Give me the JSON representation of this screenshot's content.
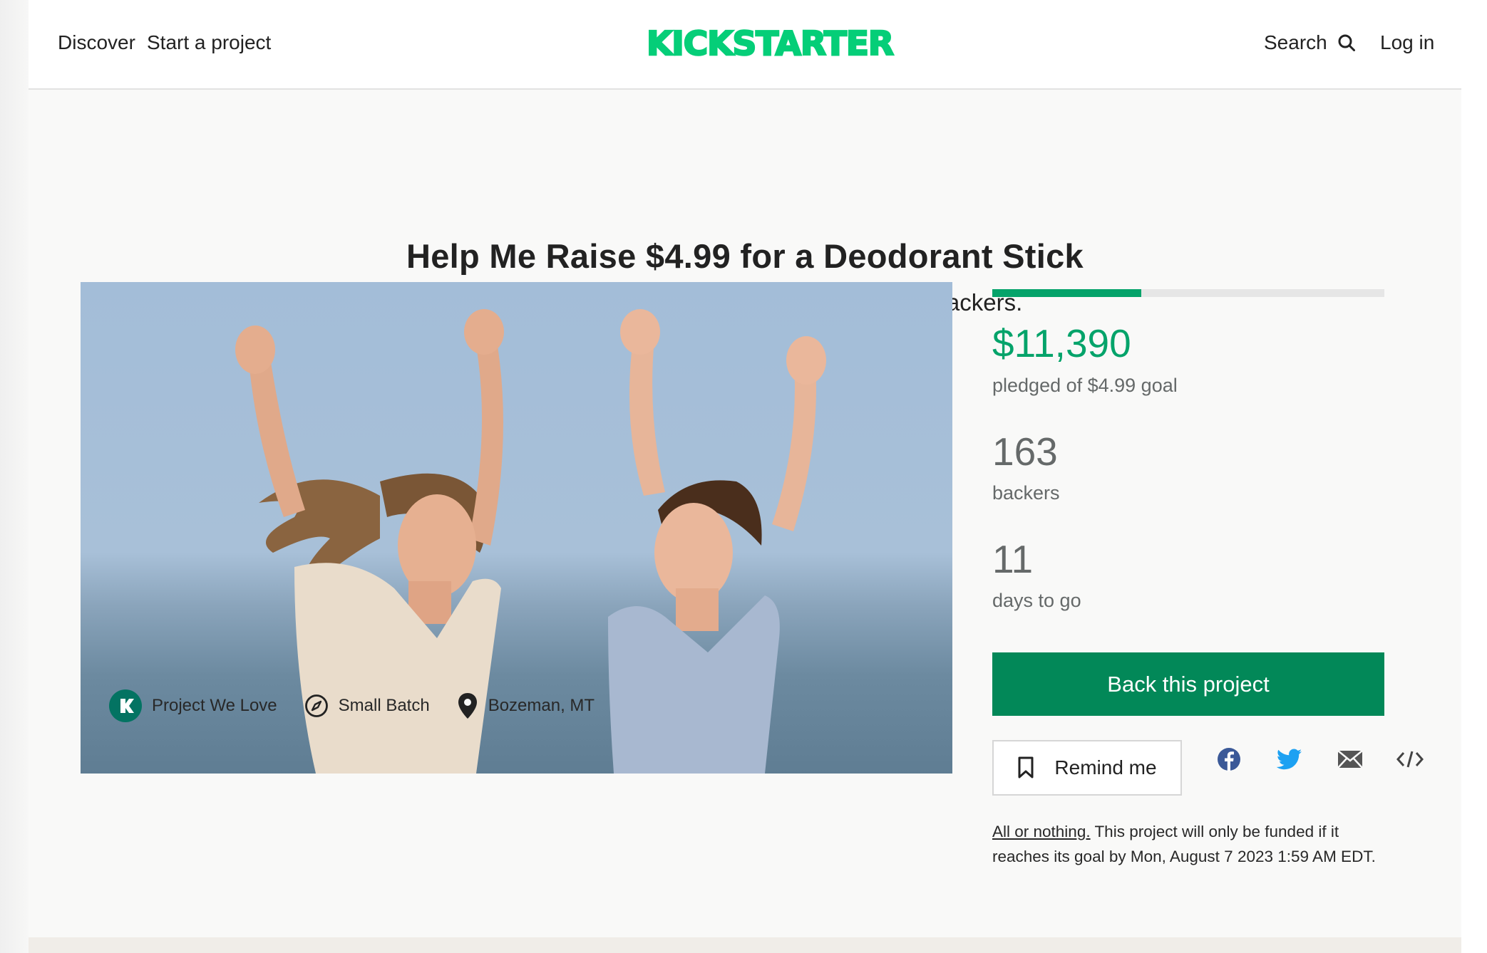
{
  "header": {
    "nav_discover": "Discover",
    "nav_start": "Start a project",
    "logo_text": "KICKSTARTER",
    "search_label": "Search",
    "login_label": "Log in"
  },
  "project": {
    "title": "Help Me Raise $4.99 for a Deodorant Stick",
    "blurb": "Natural deodorant isn't cutting it. Looking for backers."
  },
  "meta": {
    "badge": "Project We Love",
    "category": "Small Batch",
    "location": "Bozeman, MT"
  },
  "stats": {
    "progress_fraction": 0.38,
    "pledged": "$11,390",
    "pledged_label": "pledged of $4.99 goal",
    "backers": "163",
    "backers_label": "backers",
    "days": "11",
    "days_label": "days to go"
  },
  "actions": {
    "back_label": "Back this project",
    "remind_label": "Remind me"
  },
  "share_icons": [
    "facebook-icon",
    "twitter-icon",
    "email-icon",
    "embed-icon"
  ],
  "fine_print": {
    "link_text": "All or nothing.",
    "text": " This project will only be funded if it reaches its goal by Mon, August 7 2023 1:59 AM EDT."
  },
  "colors": {
    "brand_green": "#05ce78",
    "accent_green": "#028858",
    "pledged_green": "#04a36a"
  }
}
